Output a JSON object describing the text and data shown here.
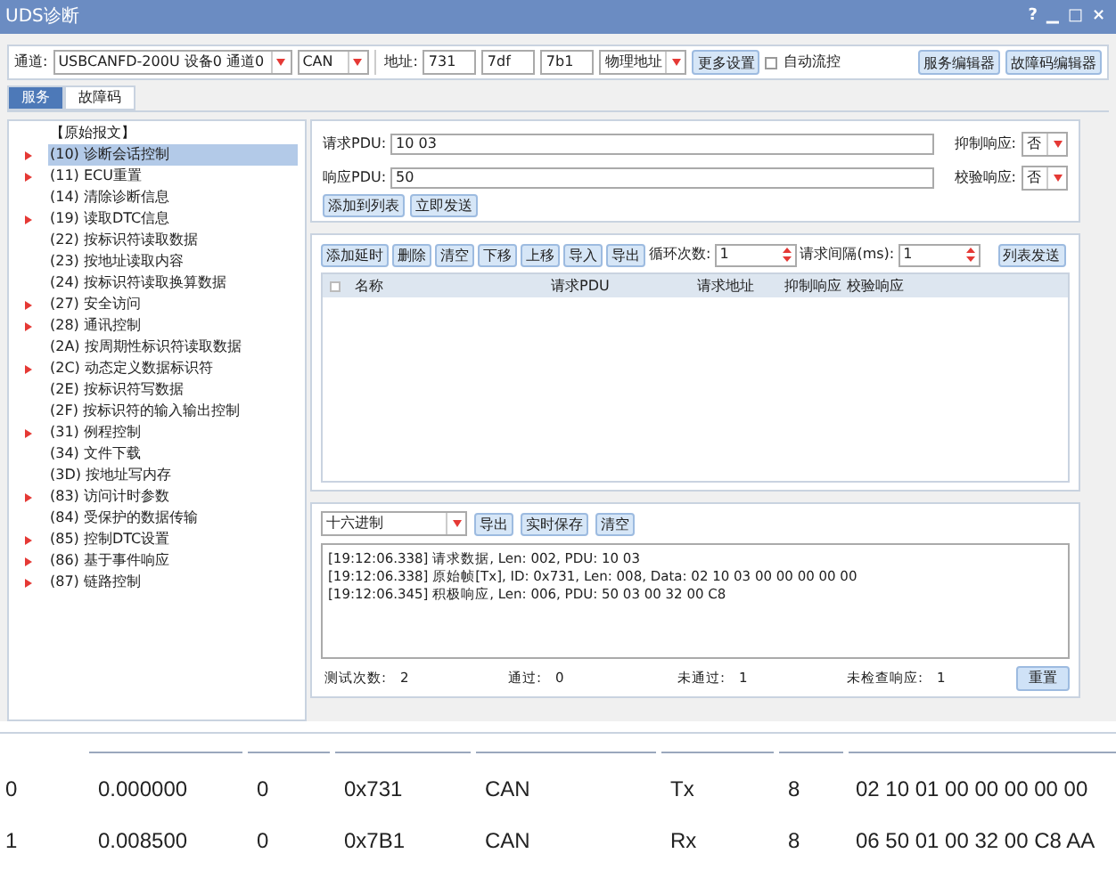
{
  "window": {
    "title": "UDS诊断",
    "controls": [
      "?",
      "▁",
      "□",
      "×"
    ]
  },
  "toolbar": {
    "channel_label": "通道:",
    "device": "USBCANFD-200U 设备0 通道0",
    "protocol": "CAN",
    "address_label": "地址:",
    "addresses": [
      "731",
      "7df",
      "7b1"
    ],
    "address_mode": "物理地址",
    "more_button": "更多设置",
    "auto_flow": {
      "label": "自动流控",
      "checked": false
    },
    "buttons": [
      "服务编辑器",
      "故障码编辑器"
    ]
  },
  "tabs": [
    {
      "label": "服务",
      "selected": true
    },
    {
      "label": "故障码",
      "selected": false
    }
  ],
  "tree": {
    "root": "【原始报文】",
    "items": [
      {
        "label": "(10) 诊断会话控制",
        "expandable": true,
        "selected": true
      },
      {
        "label": "(11) ECU重置",
        "expandable": true,
        "selected": false
      },
      {
        "label": "(14) 清除诊断信息",
        "expandable": false,
        "selected": false
      },
      {
        "label": "(19) 读取DTC信息",
        "expandable": true,
        "selected": false
      },
      {
        "label": "(22) 按标识符读取数据",
        "expandable": false,
        "selected": false
      },
      {
        "label": "(23) 按地址读取内容",
        "expandable": false,
        "selected": false
      },
      {
        "label": "(24) 按标识符读取换算数据",
        "expandable": false,
        "selected": false
      },
      {
        "label": "(27) 安全访问",
        "expandable": true,
        "selected": false
      },
      {
        "label": "(28) 通讯控制",
        "expandable": true,
        "selected": false
      },
      {
        "label": "(2A) 按周期性标识符读取数据",
        "expandable": false,
        "selected": false
      },
      {
        "label": "(2C) 动态定义数据标识符",
        "expandable": true,
        "selected": false
      },
      {
        "label": "(2E) 按标识符写数据",
        "expandable": false,
        "selected": false
      },
      {
        "label": "(2F) 按标识符的输入输出控制",
        "expandable": false,
        "selected": false
      },
      {
        "label": "(31) 例程控制",
        "expandable": true,
        "selected": false
      },
      {
        "label": "(34) 文件下载",
        "expandable": false,
        "selected": false
      },
      {
        "label": "(3D) 按地址写内存",
        "expandable": false,
        "selected": false
      },
      {
        "label": "(83) 访问计时参数",
        "expandable": true,
        "selected": false
      },
      {
        "label": "(84) 受保护的数据传输",
        "expandable": false,
        "selected": false
      },
      {
        "label": "(85) 控制DTC设置",
        "expandable": true,
        "selected": false
      },
      {
        "label": "(86) 基于事件响应",
        "expandable": true,
        "selected": false
      },
      {
        "label": "(87) 链路控制",
        "expandable": true,
        "selected": false
      }
    ]
  },
  "request": {
    "request_label": "请求PDU:",
    "request_value": "10 03",
    "suppress_label": "抑制响应:",
    "suppress_value": "否",
    "response_label": "响应PDU:",
    "response_value": "50",
    "verify_label": "校验响应:",
    "verify_value": "否",
    "buttons": [
      "添加到列表",
      "立即发送"
    ]
  },
  "list": {
    "buttons": [
      "添加延时",
      "删除",
      "清空",
      "下移",
      "上移",
      "导入",
      "导出"
    ],
    "loop_label": "循环次数:",
    "loop_value": "1",
    "interval_label": "请求间隔(ms):",
    "interval_value": "1",
    "send_button": "列表发送",
    "select_all_checked": false,
    "columns": [
      "名称",
      "请求PDU",
      "请求地址",
      "抑制响应",
      "校验响应"
    ]
  },
  "log": {
    "format": "十六进制",
    "buttons": [
      "导出",
      "实时保存",
      "清空"
    ],
    "lines": [
      "[19:12:06.338] 请求数据, Len: 002, PDU: 10 03",
      "[19:12:06.338] 原始帧[Tx], ID: 0x731, Len: 008, Data: 02 10 03 00 00 00 00 00",
      "[19:12:06.345] 积极响应, Len: 006, PDU: 50 03 00 32 00 C8"
    ],
    "stats": [
      {
        "label": "测试次数:",
        "value": "2"
      },
      {
        "label": "通过:",
        "value": "0"
      },
      {
        "label": "未通过:",
        "value": "1"
      },
      {
        "label": "未检查响应:",
        "value": "1"
      }
    ],
    "reset_button": "重置"
  },
  "frames": {
    "rows": [
      [
        "0",
        "0.000000",
        "0",
        "0x731",
        "CAN",
        "Tx",
        "8",
        "02 10 01 00 00 00 00 00"
      ],
      [
        "1",
        "0.008500",
        "0",
        "0x7B1",
        "CAN",
        "Rx",
        "8",
        "06 50 01 00 32 00 C8 AA"
      ]
    ]
  }
}
